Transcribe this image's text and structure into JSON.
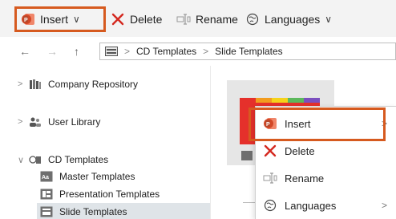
{
  "toolbar": {
    "insert_label": "Insert",
    "delete_label": "Delete",
    "rename_label": "Rename",
    "languages_label": "Languages"
  },
  "navigation": {
    "back_icon": "←",
    "forward_icon": "→",
    "up_icon": "↑",
    "breadcrumb": [
      "CD Templates",
      "Slide Templates"
    ]
  },
  "tree": {
    "items": [
      {
        "label": "Company Repository"
      },
      {
        "label": "User Library"
      },
      {
        "label": "CD Templates"
      },
      {
        "label": "Master Templates"
      },
      {
        "label": "Presentation Templates"
      },
      {
        "label": "Slide Templates"
      }
    ]
  },
  "context_menu": {
    "items": [
      {
        "label": "Insert"
      },
      {
        "label": "Delete"
      },
      {
        "label": "Rename"
      },
      {
        "label": "Languages"
      }
    ]
  },
  "colors": {
    "highlight": "#d65a1f",
    "delete_red": "#d4281f",
    "ppt_red": "#d24726"
  }
}
